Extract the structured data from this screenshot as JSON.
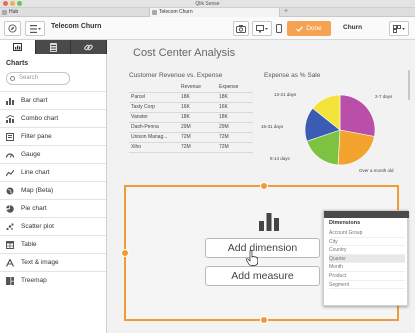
{
  "window": {
    "title": "Qlik Sense"
  },
  "tabs": [
    {
      "label": "Hub",
      "active": false
    },
    {
      "label": "Telecom Churn",
      "active": true
    }
  ],
  "toolbar": {
    "app_name": "Telecom Churn",
    "done_label": "Done",
    "sheet_name": "Churn",
    "accent": "#f5a253"
  },
  "left_panel": {
    "heading": "Charts",
    "search_placeholder": "Search",
    "items": [
      {
        "label": "Bar chart",
        "icon": "bar-chart-icon"
      },
      {
        "label": "Combo chart",
        "icon": "combo-chart-icon"
      },
      {
        "label": "Filter pane",
        "icon": "filter-pane-icon"
      },
      {
        "label": "Gauge",
        "icon": "gauge-icon"
      },
      {
        "label": "Line chart",
        "icon": "line-chart-icon"
      },
      {
        "label": "Map (Beta)",
        "icon": "map-icon"
      },
      {
        "label": "Pie chart",
        "icon": "pie-chart-icon"
      },
      {
        "label": "Scatter plot",
        "icon": "scatter-plot-icon"
      },
      {
        "label": "Table",
        "icon": "table-icon"
      },
      {
        "label": "Text & image",
        "icon": "text-image-icon"
      },
      {
        "label": "Treemap",
        "icon": "treemap-icon"
      }
    ]
  },
  "main": {
    "sheet_title": "Cost Center Analysis",
    "table": {
      "title": "Customer Revenue vs. Expense",
      "columns": [
        "",
        "Revenue",
        "Expense"
      ],
      "rows": [
        [
          "Parcel",
          "18K",
          "18K"
        ],
        [
          "Tasty Corp",
          "16K",
          "16K"
        ],
        [
          "Vanster",
          "18K",
          "18K"
        ],
        [
          "Dash-Penna",
          "29M",
          "29M"
        ],
        [
          "Unison Manag...",
          "72M",
          "72M"
        ],
        [
          "Xiho",
          "72M",
          "72M"
        ]
      ]
    },
    "pie": {
      "title": "Expense as % Sale",
      "labels": [
        "2-7 days",
        "13-21 days",
        "15-31 days",
        "8-14 days",
        "Over a month old"
      ],
      "slice_colors": [
        "#b94fa8",
        "#f3a42e",
        "#7ec242",
        "#3a5db3",
        "#f4e33a"
      ]
    },
    "dropzone": {
      "add_dimension": "Add dimension",
      "add_measure": "Add measure",
      "accent": "#f09a3a"
    },
    "dimensions_menu": {
      "title": "Dimensions",
      "items": [
        "Account Group",
        "City",
        "Country",
        "Quarter",
        "Month",
        "Product",
        "Segment"
      ],
      "highlighted": "Quarter"
    }
  }
}
